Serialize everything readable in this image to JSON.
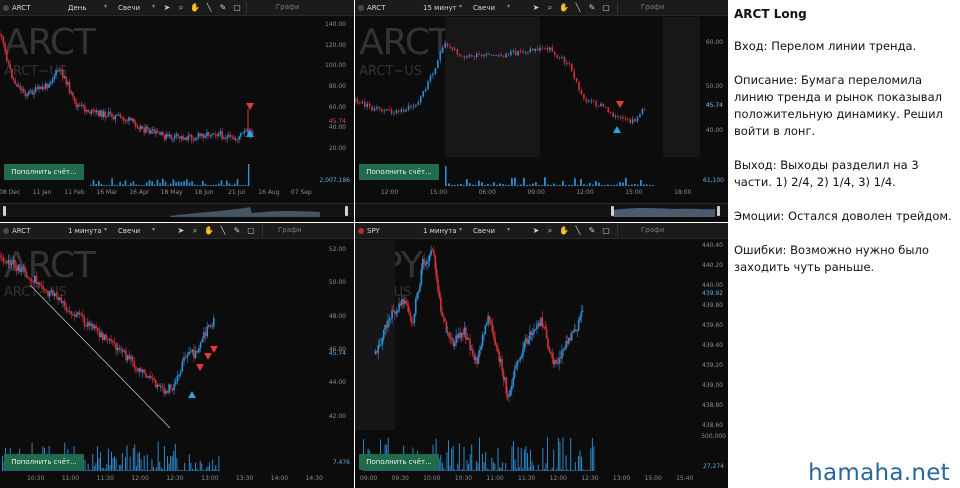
{
  "panels": [
    {
      "id": "p1",
      "toolbar": {
        "symbol": "ARCT",
        "interval": "День",
        "chart_type": "Свечи",
        "graph_label": "Графи"
      },
      "watermark": {
        "big": "ARCT",
        "small": "ARCT~US"
      },
      "y_ticks": [
        "140.00",
        "120.00",
        "100.00",
        "80.00",
        "60.00",
        "40.00",
        "20.00"
      ],
      "y_range": [
        12,
        148
      ],
      "current_price": "45.74",
      "x_ticks": [
        "08 Dec",
        "11 Jan",
        "11 Feb",
        "16 Mar",
        "16 Apr",
        "18 May",
        "18 Jun",
        "21 Jul",
        "16 Aug",
        "07 Sep"
      ],
      "volume_label": "2,007,186",
      "fund_button": "Пополнить счёт...",
      "has_navigator": true
    },
    {
      "id": "p2",
      "toolbar": {
        "symbol": "ARCT",
        "interval": "15 минут",
        "chart_type": "Свечи",
        "graph_label": "Графи"
      },
      "watermark": {
        "big": "ARCT",
        "small": "ARCT~US"
      },
      "y_ticks": [
        "60.00",
        "50.00",
        "45.74",
        "40.00"
      ],
      "y_range": [
        34,
        66
      ],
      "current_price": "45.74",
      "x_ticks": [
        "12:00",
        "15:00",
        "06:00",
        "09:00",
        "12:00",
        "15:00",
        "18:00"
      ],
      "volume_label": "61,100",
      "fund_button": "Пополнить счёт...",
      "has_navigator": true
    },
    {
      "id": "p3",
      "toolbar": {
        "symbol": "ARCT",
        "interval": "1 минута",
        "chart_type": "Свечи",
        "graph_label": "Графи"
      },
      "watermark": {
        "big": "ARCT",
        "small": "ARCT~US"
      },
      "y_ticks": [
        "52.00",
        "50.00",
        "48.00",
        "46.00",
        "44.00",
        "42.00"
      ],
      "y_range": [
        41.2,
        52.6
      ],
      "current_price": "45.74",
      "x_ticks": [
        "10:30",
        "11:00",
        "11:30",
        "12:00",
        "12:30",
        "13:00",
        "13:30",
        "14:00",
        "14:30"
      ],
      "volume_label": "7,476",
      "fund_button": "Пополнить счёт...",
      "has_navigator": false
    },
    {
      "id": "p4",
      "toolbar": {
        "symbol": "SPY",
        "interval": "1 минута",
        "chart_type": "Свечи",
        "graph_label": "Графи"
      },
      "watermark": {
        "big": "SPY",
        "small": "SPY~US"
      },
      "y_ticks": [
        "440.40",
        "440.20",
        "440.00",
        "439.80",
        "439.60",
        "439.40",
        "439.20",
        "439.00",
        "438.80",
        "438.60"
      ],
      "y_range": [
        438.56,
        440.46
      ],
      "current_price": "439.92",
      "x_ticks": [
        "09:00",
        "09:30",
        "10:00",
        "10:30",
        "11:00",
        "11:30",
        "12:00",
        "12:30",
        "13:00",
        "15:00",
        "15:40"
      ],
      "volume_label": "27,274",
      "volume_scale_top": "500,000",
      "fund_button": "Пополнить счёт...",
      "has_navigator": false
    }
  ],
  "notes": {
    "title": "ARCT Long",
    "entry": "Вход: Перелом линии тренда.",
    "description": "Описание: Бумага переломила линию тренда и рынок показывал положительную динамику. Решил войти в лонг.",
    "exit": "Выход: Выходы разделил на 3 части. 1) 2/4, 2) 1/4, 3) 1/4.",
    "emotions": "Эмоции: Остался доволен трейдом.",
    "mistakes": "Ошибки: Возможно нужно было заходить чуть раньше."
  },
  "brand": "hamaha.net",
  "colors": {
    "up": "#2f8fd6",
    "down": "#d3323a",
    "panel_bg": "#0c0c0c",
    "fund_button": "#1f6b4b",
    "brand": "#27679b"
  }
}
